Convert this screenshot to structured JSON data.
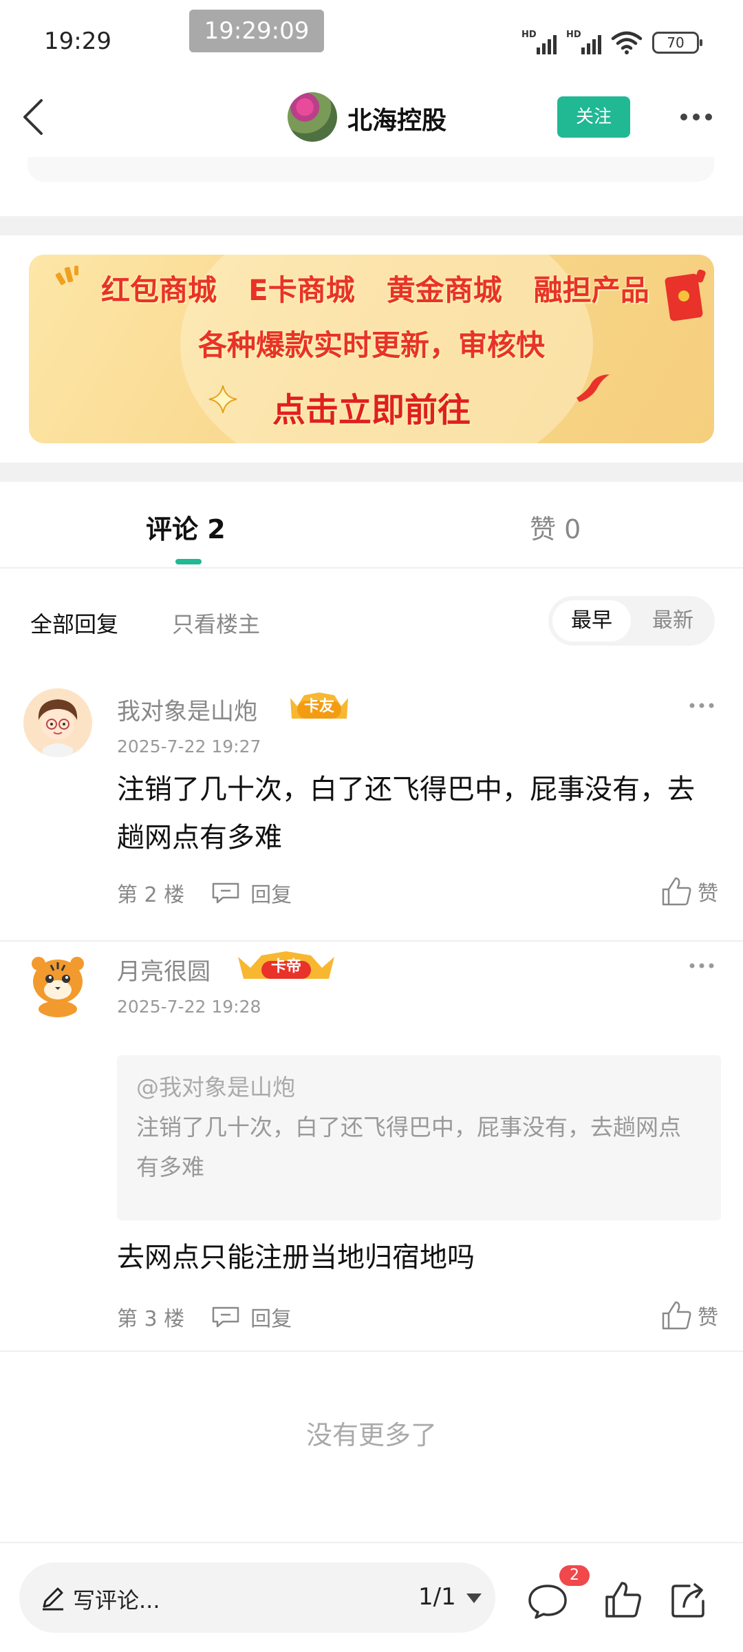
{
  "status_bar": {
    "time": "19:29",
    "clock_overlay": "19:29:09",
    "battery": "70",
    "network_label": "HD"
  },
  "header": {
    "user_name": "北海控股",
    "follow_label": "关注",
    "accent_color": "#21b894"
  },
  "banner": {
    "items": [
      "红包商城",
      "E卡商城",
      "黄金商城",
      "融担产品"
    ],
    "subtitle": "各种爆款实时更新，审核快",
    "cta": "点击立即前往"
  },
  "tabs": {
    "comments": "评论 2",
    "likes": "赞 0",
    "active": "comments"
  },
  "filters": {
    "all": "全部回复",
    "owner_only": "只看楼主",
    "sort_earliest": "最早",
    "sort_newest": "最新",
    "sort_selected": "最早"
  },
  "comments": [
    {
      "user": "我对象是山炮",
      "badge": "卡友",
      "time": "2025-7-22 19:27",
      "text": "注销了几十次，白了还飞得巴中，屁事没有，去趟网点有多难",
      "floor": "第 2 楼",
      "reply_label": "回复",
      "like_label": "赞"
    },
    {
      "user": "月亮很圆",
      "badge": "卡帝",
      "time": "2025-7-22 19:28",
      "quote_user": "@我对象是山炮",
      "quote_text": "注销了几十次，白了还飞得巴中，屁事没有，去趟网点有多难",
      "text": "去网点只能注册当地归宿地吗",
      "floor": "第 3 楼",
      "reply_label": "回复",
      "like_label": "赞"
    }
  ],
  "no_more": "没有更多了",
  "bottom_bar": {
    "write_placeholder": "写评论...",
    "page_indicator": "1/1",
    "comment_count": "2"
  }
}
